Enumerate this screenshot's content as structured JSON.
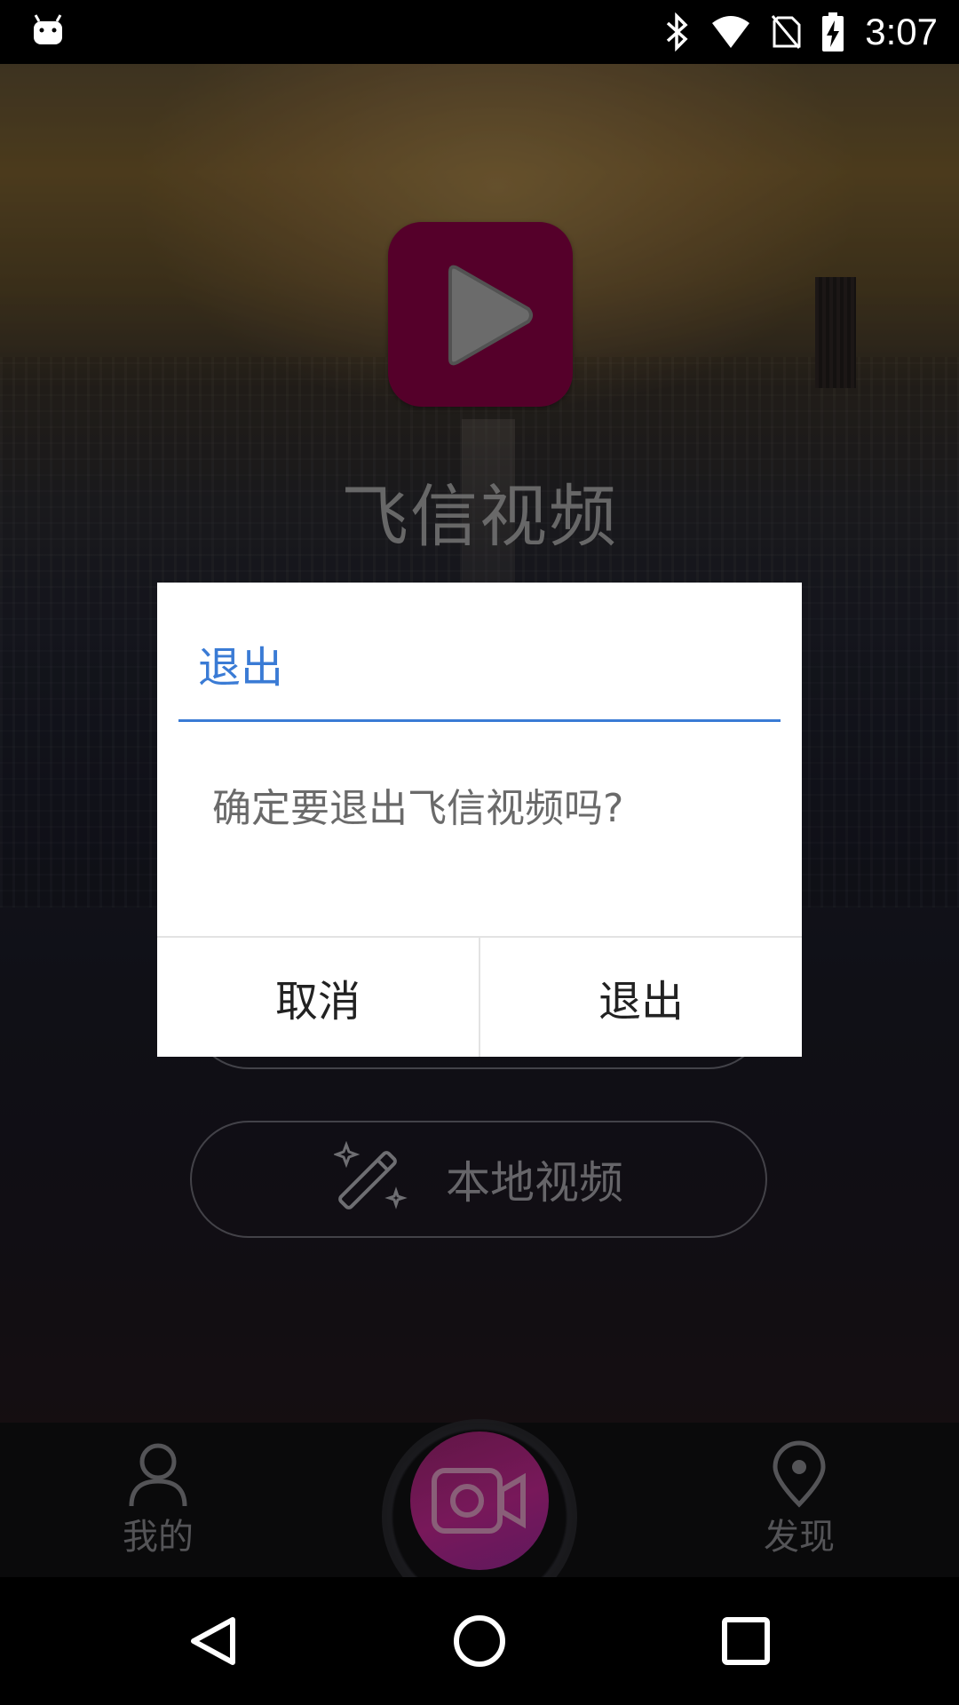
{
  "status_bar": {
    "time": "3:07"
  },
  "app": {
    "title": "飞信视频"
  },
  "home": {
    "local_video_label": "本地视频"
  },
  "bottom_nav": {
    "me_label": "我的",
    "discover_label": "发现"
  },
  "dialog": {
    "title": "退出",
    "message": "确定要退出飞信视频吗?",
    "cancel_label": "取消",
    "confirm_label": "退出"
  },
  "colors": {
    "accent": "#3a7bd5",
    "logo_bg": "#6e0037",
    "record_button": "#9a1f74"
  },
  "icons": [
    "android-icon",
    "bluetooth-icon",
    "wifi-icon",
    "no-sim-icon",
    "battery-charging-icon",
    "play-icon",
    "magic-wand-icon",
    "person-icon",
    "camera-icon",
    "location-pin-icon",
    "back-icon",
    "home-icon",
    "recents-icon"
  ]
}
